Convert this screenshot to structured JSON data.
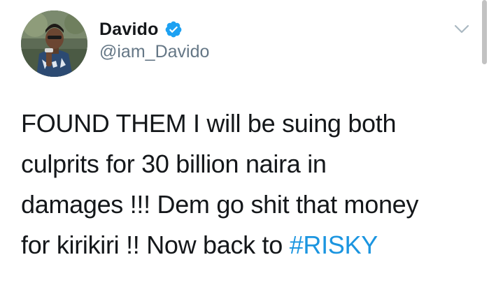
{
  "tweet": {
    "author": {
      "display_name": "Davido",
      "handle": "@iam_Davido",
      "verified": true
    },
    "text_lines": [
      "FOUND THEM I will be suing both",
      "culprits for 30 billion naira in",
      "damages !!! Dem go shit that money",
      "for kirikiri !! Now back to "
    ],
    "hashtag": "#RISKY",
    "icons": {
      "verified": "verified-badge-icon",
      "menu": "chevron-down-icon"
    }
  },
  "colors": {
    "text": "#14171a",
    "secondary": "#657786",
    "link": "#1b95e0",
    "verified_badge": "#1da1f2"
  }
}
